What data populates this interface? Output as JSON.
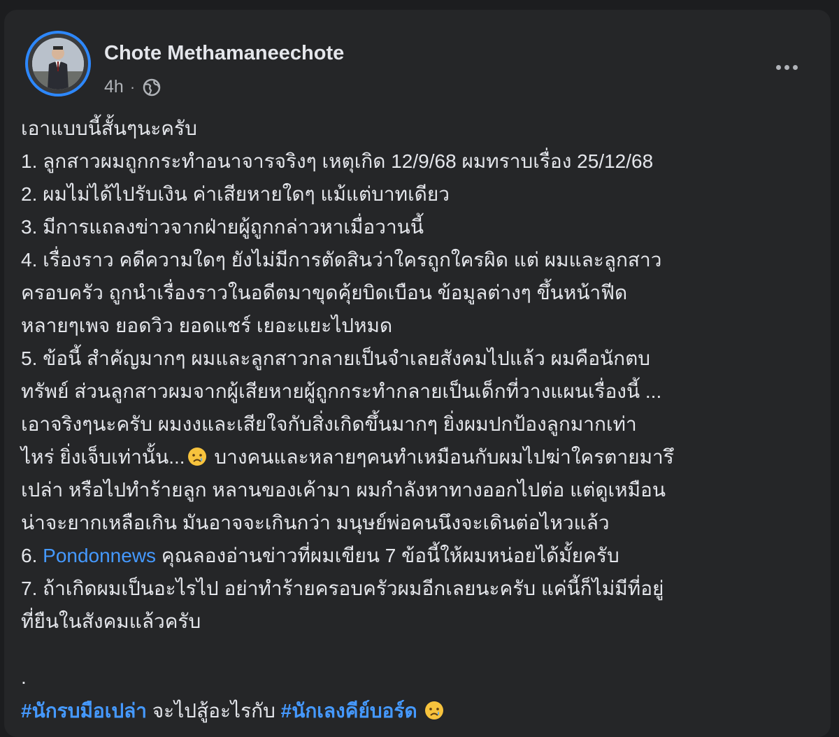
{
  "post": {
    "author": "Chote Methamaneechote",
    "time": "4h",
    "dot": "·",
    "privacy_icon": "globe-icon",
    "more_icon": "more-options-icon",
    "lines": [
      "เอาแบบนี้สั้นๆนะครับ",
      "1. ลูกสาวผมถูกกระทำอนาจารจริงๆ เหตุเกิด 12/9/68 ผมทราบเรื่อง 25/12/68",
      "2. ผมไม่ได้ไปรับเงิน ค่าเสียหายใดๆ แม้แต่บาทเดียว",
      "3. มีการแถลงข่าวจากฝ่ายผู้ถูกกล่าวหาเมื่อวานนี้",
      "4. เรื่องราว คดีความใดๆ ยังไม่มีการตัดสินว่าใครถูกใครผิด แต่ ผมและลูกสาว",
      "ครอบครัว ถูกนำเรื่องราวในอดีตมาขุดคุ้ยบิดเบือน ข้อมูลต่างๆ ขึ้นหน้าฟีด",
      "หลายๆเพจ ยอดวิว ยอดแชร์ เยอะแยะไปหมด",
      "5. ข้อนี้ สำคัญมากๆ ผมและลูกสาวกลายเป็นจำเลยสังคมไปแล้ว ผมคือนักตบ",
      "ทรัพย์ ส่วนลูกสาวผมจากผู้เสียหายผู้ถูกกระทำกลายเป็นเด็กที่วางแผนเรื่องนี้ ...",
      "เอาจริงๆนะครับ ผมงงและเสียใจกับสิ่งเกิดขึ้นมากๆ  ยิ่งผมปกป้องลูกมากเท่า"
    ],
    "line_emoji_before": "ไหร่ ยิ่งเจ็บเท่านั้น...",
    "line_emoji_after": " บางคนและหลายๆคนทำเหมือนกับผมไปฆ่าใครตายมารึ",
    "lines2": [
      "เปล่า หรือไปทำร้ายลูก หลานของเค้ามา ผมกำลังหาทางออกไปต่อ แต่ดูเหมือน",
      "น่าจะยากเหลือเกิน มันอาจจะเกินกว่า มนุษย์พ่อคนนึงจะเดินต่อไหวแล้ว"
    ],
    "item6_prefix": "6. ",
    "item6_link": "Pondonnews",
    "item6_rest": " คุณลองอ่านข่าวที่ผมเขียน 7 ข้อนี้ให้ผมหน่อยได้มั้ยครับ",
    "lines3": [
      "7. ถ้าเกิดผมเป็นอะไรไป อย่าทำร้ายครอบครัวผมอีกเลยนะครับ แค่นี้ก็ไม่มีที่อยู่",
      "ที่ยืนในสังคมแล้วครับ",
      "",
      "."
    ],
    "hashtag1": "#นักรบมือเปล่า",
    "hashtag_mid": " จะไปสู้อะไรกับ ",
    "hashtag2": "#นักเลงคีย์บอร์ด",
    "emoji_name": "sad-face-emoji"
  }
}
